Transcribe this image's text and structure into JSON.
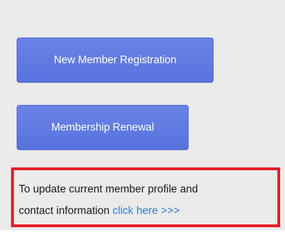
{
  "buttons": {
    "new_member": "New Member Registration",
    "renewal": "Membership Renewal"
  },
  "notice": {
    "line1": "To update current member profile and",
    "line2_prefix": "contact information",
    "link_text": "click here >>>"
  },
  "colors": {
    "button_blue": "#5d78e2",
    "notice_border": "#e61c24",
    "link_blue": "#2f7fce",
    "panel_bg": "#ebebeb"
  }
}
